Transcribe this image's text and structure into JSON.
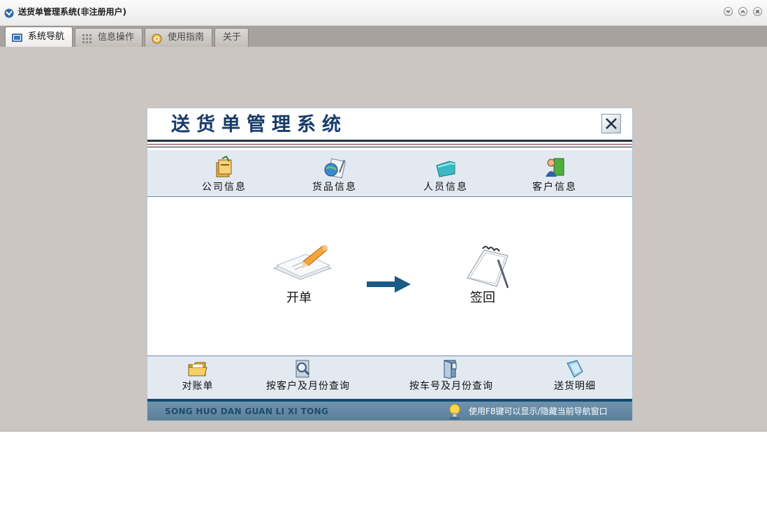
{
  "window": {
    "title": "送货单管理系统(非注册用户)",
    "controls": [
      "minimize",
      "restore",
      "close"
    ]
  },
  "tabs": [
    {
      "label": "系统导航",
      "icon": "monitor-icon",
      "active": true
    },
    {
      "label": "信息操作",
      "icon": "grid-icon",
      "active": false
    },
    {
      "label": "使用指南",
      "icon": "help-icon",
      "active": false
    },
    {
      "label": "关于",
      "icon": "",
      "active": false
    }
  ],
  "panel": {
    "title": "送货单管理系统",
    "top_nav": [
      {
        "label": "公司信息",
        "icon": "company-icon"
      },
      {
        "label": "货品信息",
        "icon": "goods-icon"
      },
      {
        "label": "人员信息",
        "icon": "folder-icon"
      },
      {
        "label": "客户信息",
        "icon": "customer-icon"
      }
    ],
    "main": {
      "open_order": {
        "label": "开单",
        "icon": "pen-paper-icon"
      },
      "sign_return": {
        "label": "签回",
        "icon": "notepad-icon"
      }
    },
    "bottom_nav": [
      {
        "label": "对账单",
        "icon": "open-folder-icon"
      },
      {
        "label": "按客户及月份查询",
        "icon": "magnifier-doc-icon"
      },
      {
        "label": "按车号及月份查询",
        "icon": "door-icon"
      },
      {
        "label": "送货明细",
        "icon": "bookmark-icon"
      }
    ],
    "footer": {
      "left_text": "SONG HUO DAN GUAN LI XI TONG",
      "right_text": "使用F8键可以显示/隐藏当前导航窗口"
    }
  },
  "colors": {
    "window_bg": "#cbc6c2",
    "title_text": "#173b6a",
    "nav_bg": "#e2e9f1",
    "accent": "#13496e",
    "arrow": "#1a5a85",
    "footer_bg": "#6f93ad"
  }
}
